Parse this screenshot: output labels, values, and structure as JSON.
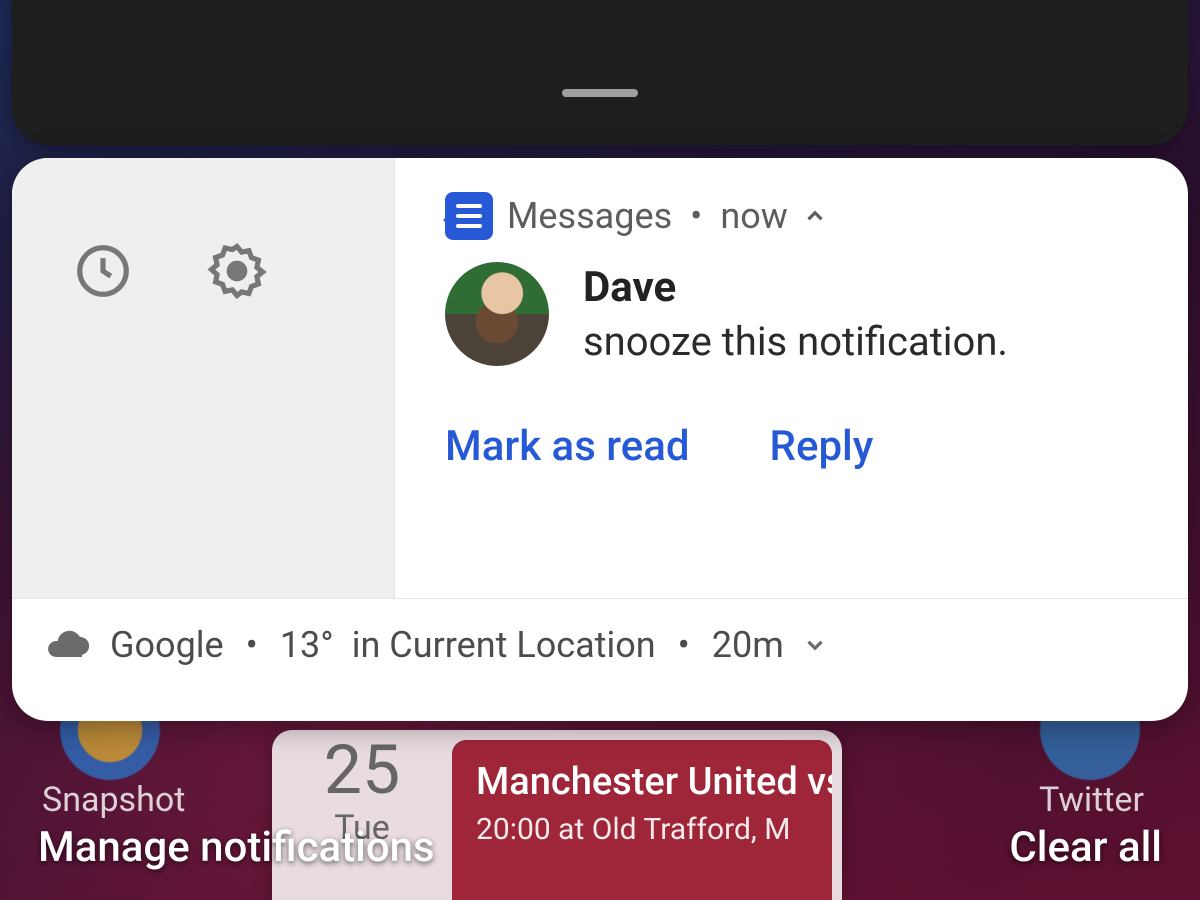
{
  "quick_settings": {
    "toggles": [
      {
        "active": true
      },
      {
        "active": false
      },
      {
        "active": false
      },
      {
        "active": false
      },
      {
        "active": false
      },
      {
        "active": false
      }
    ]
  },
  "notification": {
    "app_name": "Messages",
    "time": "now",
    "sender": "Dave",
    "message": "snooze this notification.",
    "actions": {
      "mark_read": "Mark as read",
      "reply": "Reply"
    }
  },
  "weather": {
    "source": "Google",
    "temp": "13°",
    "location_label": "in Current Location",
    "age": "20m"
  },
  "footer": {
    "manage": "Manage notifications",
    "clear": "Clear all"
  },
  "background": {
    "app_left_label": "Snapshot",
    "app_right_label": "Twitter",
    "calendar": {
      "day_num": "25",
      "day_name": "Tue",
      "event_title": "Manchester United vs D",
      "event_sub": "20:00 at Old Trafford, M"
    }
  }
}
